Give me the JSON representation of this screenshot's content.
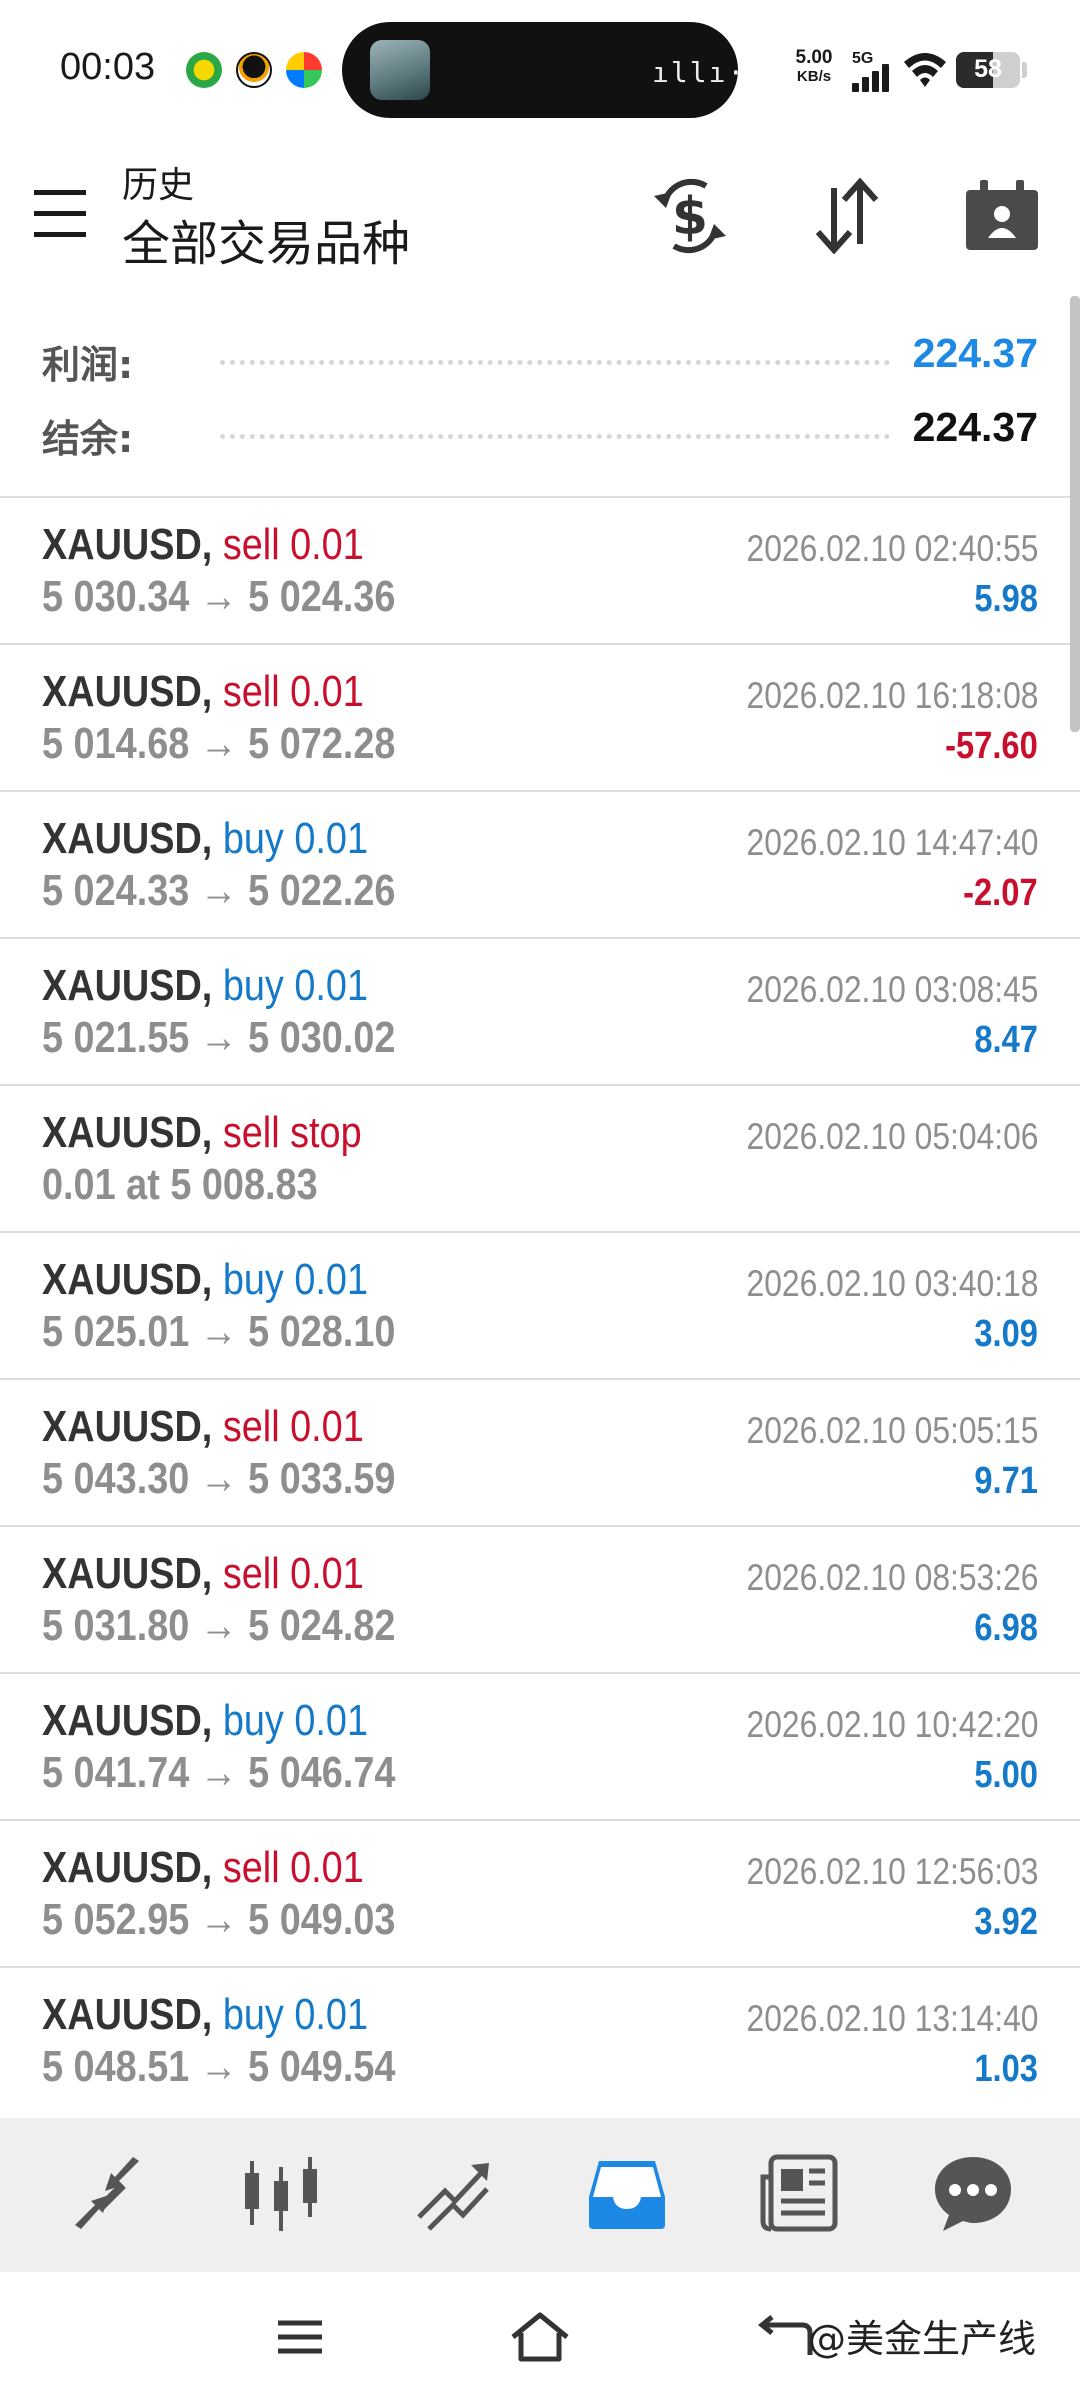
{
  "status_bar": {
    "time": "00:03",
    "net_speed_value": "5.00",
    "net_speed_unit": "KB/s",
    "network": "5G",
    "battery": "58",
    "battery_level": 0.58,
    "icons": [
      "app-notification-icon",
      "qq-icon",
      "app-notification-icon",
      "wifi-icon",
      "signal-icon",
      "battery-icon"
    ]
  },
  "header": {
    "subtitle": "历史",
    "title": "全部交易品种",
    "actions": [
      "deposit-withdraw-icon",
      "sort-icon",
      "calendar-icon"
    ]
  },
  "summary": {
    "profit_label": "利润:",
    "profit_value": "224.37",
    "balance_label": "结余:",
    "balance_value": "224.37"
  },
  "colors": {
    "sell": "#c8102e",
    "buy": "#1479c9",
    "positive": "#1479c9",
    "negative": "#c8102e",
    "accent": "#1e88e5",
    "muted": "#8e8e8e"
  },
  "deals": [
    {
      "symbol": "XAUUSD,",
      "type": "sell 0.01",
      "side": "sell",
      "prices": "5 030.34 → 5 024.36",
      "time": "2026.02.10 02:40:55",
      "profit": "5.98"
    },
    {
      "symbol": "XAUUSD,",
      "type": "sell 0.01",
      "side": "sell",
      "prices": "5 014.68 → 5 072.28",
      "time": "2026.02.10 16:18:08",
      "profit": "-57.60"
    },
    {
      "symbol": "XAUUSD,",
      "type": "buy 0.01",
      "side": "buy",
      "prices": "5 024.33 → 5 022.26",
      "time": "2026.02.10 14:47:40",
      "profit": "-2.07"
    },
    {
      "symbol": "XAUUSD,",
      "type": "buy 0.01",
      "side": "buy",
      "prices": "5 021.55 → 5 030.02",
      "time": "2026.02.10 03:08:45",
      "profit": "8.47"
    },
    {
      "symbol": "XAUUSD,",
      "type": "sell stop",
      "side": "sell",
      "prices": "0.01 at 5 008.83",
      "time": "2026.02.10 05:04:06",
      "profit": ""
    },
    {
      "symbol": "XAUUSD,",
      "type": "buy 0.01",
      "side": "buy",
      "prices": "5 025.01 → 5 028.10",
      "time": "2026.02.10 03:40:18",
      "profit": "3.09"
    },
    {
      "symbol": "XAUUSD,",
      "type": "sell 0.01",
      "side": "sell",
      "prices": "5 043.30 → 5 033.59",
      "time": "2026.02.10 05:05:15",
      "profit": "9.71"
    },
    {
      "symbol": "XAUUSD,",
      "type": "sell 0.01",
      "side": "sell",
      "prices": "5 031.80 → 5 024.82",
      "time": "2026.02.10 08:53:26",
      "profit": "6.98"
    },
    {
      "symbol": "XAUUSD,",
      "type": "buy 0.01",
      "side": "buy",
      "prices": "5 041.74 → 5 046.74",
      "time": "2026.02.10 10:42:20",
      "profit": "5.00"
    },
    {
      "symbol": "XAUUSD,",
      "type": "sell 0.01",
      "side": "sell",
      "prices": "5 052.95 → 5 049.03",
      "time": "2026.02.10 12:56:03",
      "profit": "3.92"
    },
    {
      "symbol": "XAUUSD,",
      "type": "buy 0.01",
      "side": "buy",
      "prices": "5 048.51 → 5 049.54",
      "time": "2026.02.10 13:14:40",
      "profit": "1.03"
    }
  ],
  "bottom_nav": {
    "tabs": [
      "quotes-icon",
      "chart-icon",
      "trade-icon",
      "history-icon",
      "news-icon",
      "chat-icon"
    ],
    "active": "history-icon"
  },
  "system_nav": {
    "buttons": [
      "menu-icon",
      "home-icon",
      "back-icon"
    ],
    "watermark": "@美金生产线"
  }
}
